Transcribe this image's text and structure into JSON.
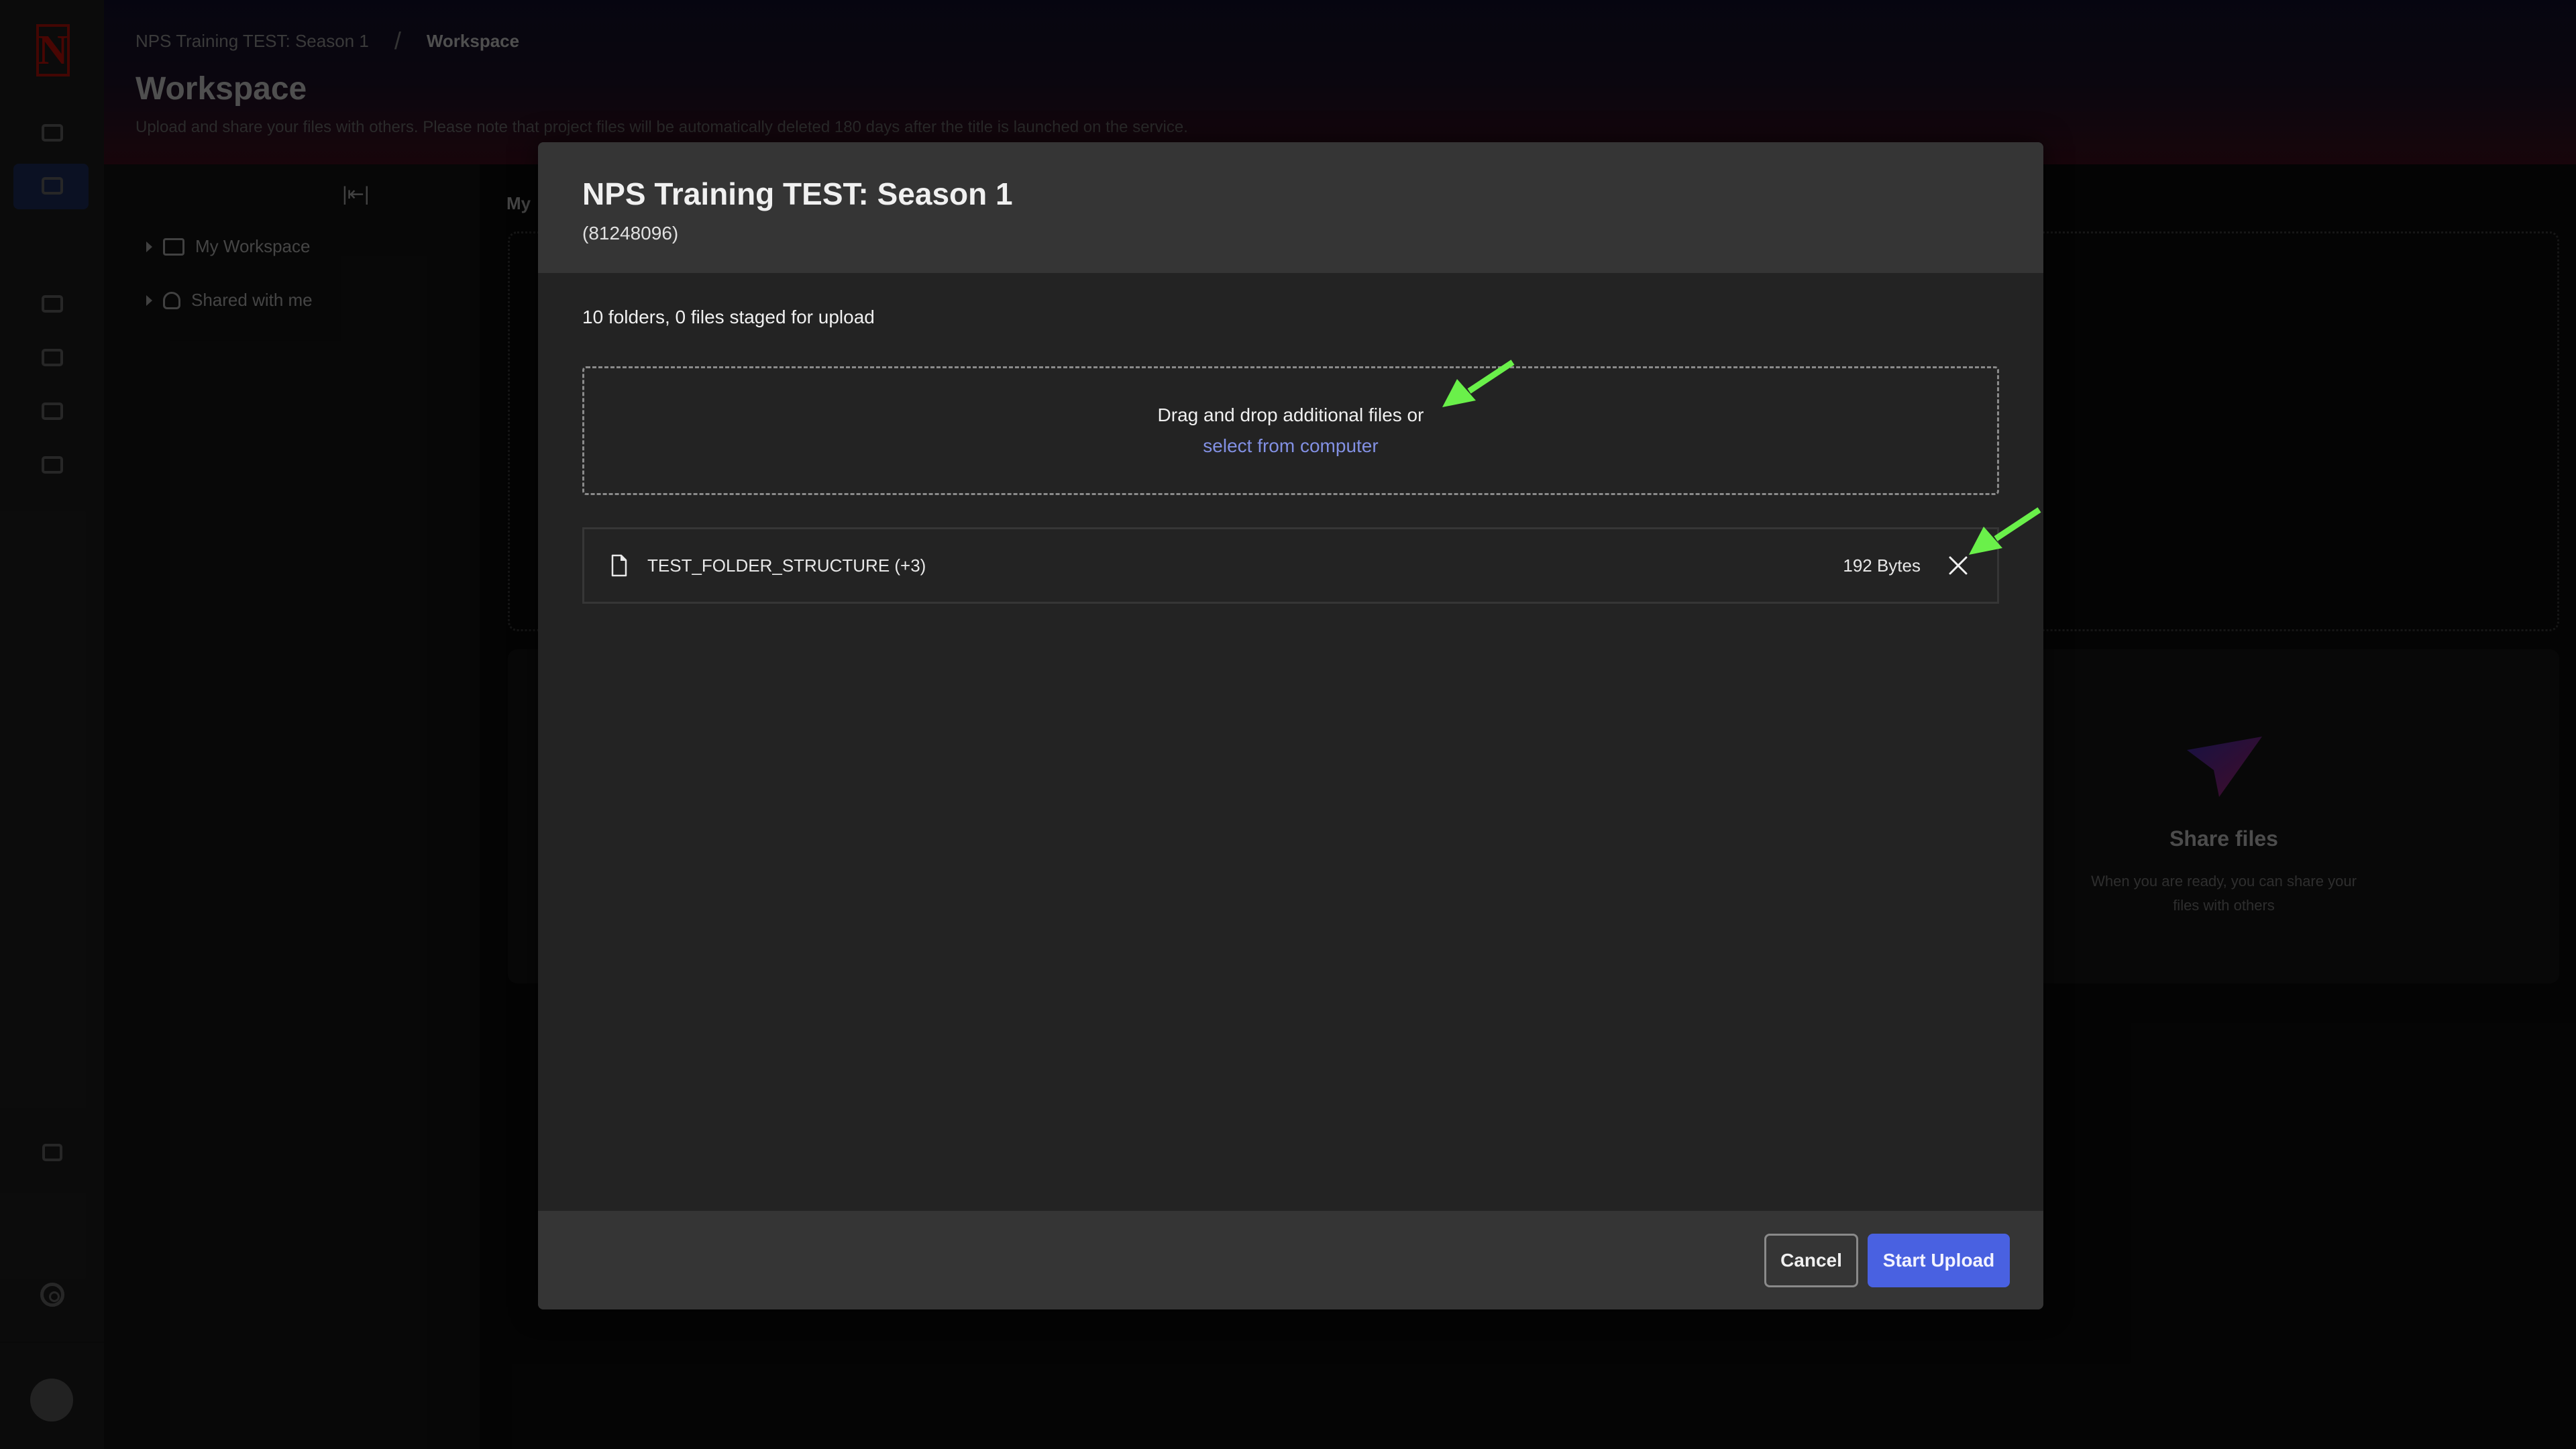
{
  "app": {
    "breadcrumb": [
      "NPS Training TEST: Season 1",
      "Workspace"
    ],
    "breadcrumb_separator": "/",
    "page_title": "Workspace",
    "page_description": "Upload and share your files with others. Please note that project files will be automatically deleted 180 days after the title is launched on the service.",
    "tree": {
      "items": [
        {
          "label": "My Workspace",
          "icon": "folder-icon"
        },
        {
          "label": "Shared with me",
          "icon": "people-icon"
        }
      ]
    },
    "content_label": "My",
    "share_card": {
      "title": "Share files",
      "description": "When you are ready, you can share your files with others"
    },
    "rail_icons": [
      "netflix-logo",
      "play-icon",
      "folder-icon",
      "card-icon",
      "inbox-check-icon",
      "inbox-edit-icon",
      "export-icon",
      "expand-icon",
      "gear-icon",
      "avatar"
    ]
  },
  "modal": {
    "title": "NPS Training TEST: Season 1",
    "subtitle": "(81248096)",
    "staged_summary": "10 folders, 0 files staged for upload",
    "dropzone": {
      "text": "Drag and drop additional files or",
      "link": "select from computer"
    },
    "files": [
      {
        "name": "TEST_FOLDER_STRUCTURE (+3)",
        "size": "192 Bytes"
      }
    ],
    "buttons": {
      "cancel": "Cancel",
      "start": "Start Upload"
    }
  },
  "colors": {
    "accent": "#4961e1",
    "link": "#8290e3",
    "annotation": "#6af04a",
    "brand": "#b0120a"
  }
}
